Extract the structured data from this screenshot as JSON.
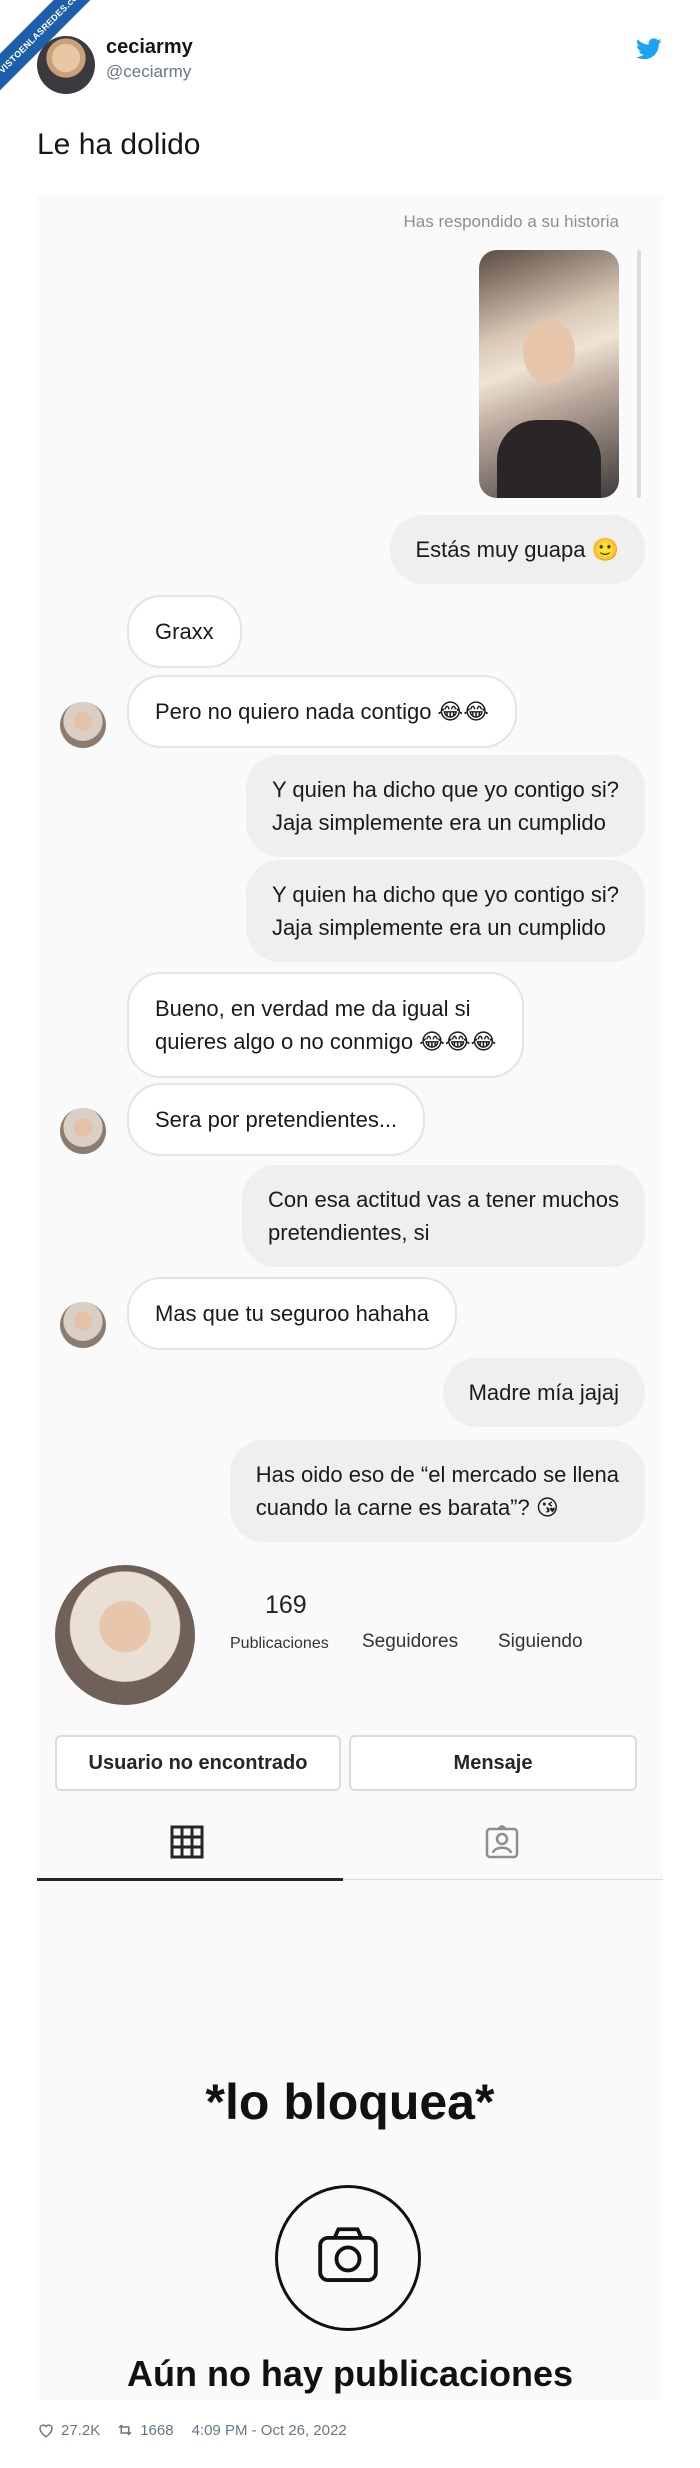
{
  "tweet": {
    "ribbon": "VISTOENLASREDES.com",
    "author_name": "ceciarmy",
    "author_handle": "@ceciarmy",
    "text": "Le ha dolido",
    "likes": "27.2K",
    "retweets": "1668",
    "timestamp": "4:09 PM - Oct 26, 2022"
  },
  "chat": {
    "reply_note": "Has respondido a su historia",
    "messages": [
      {
        "side": "out",
        "text": "Estás muy guapa 🙂"
      },
      {
        "side": "in",
        "text": "Graxx"
      },
      {
        "side": "in",
        "text": "Pero no quiero nada contigo 😂😂"
      },
      {
        "side": "out",
        "text": "Y quien ha dicho que yo contigo si?\nJaja simplemente era un cumplido"
      },
      {
        "side": "out",
        "text": "Y quien ha dicho que yo contigo si?\nJaja simplemente era un cumplido"
      },
      {
        "side": "in",
        "text": "Bueno, en verdad me da igual si\nquieres algo o no conmigo 😂😂😂"
      },
      {
        "side": "in",
        "text": "Sera por pretendientes..."
      },
      {
        "side": "out",
        "text": "Con esa actitud vas a tener muchos\npretendientes, si"
      },
      {
        "side": "in",
        "text": "Mas que tu seguroo hahaha"
      },
      {
        "side": "out",
        "text": "Madre mía jajaj"
      },
      {
        "side": "out",
        "text": "Has oido eso de “el mercado se llena\ncuando la carne es barata”? 😘"
      }
    ]
  },
  "profile": {
    "posts_count": "169",
    "posts_label": "Publicaciones",
    "followers_label": "Seguidores",
    "following_label": "Siguiendo",
    "user_button": "Usuario no encontrado",
    "message_button": "Mensaje",
    "caption": "*lo bloquea*",
    "empty_state": "Aún no hay publicaciones"
  },
  "colors": {
    "twitter_blue": "#1da1f2",
    "incoming_bubble": "#ffffff",
    "outgoing_bubble": "#efefef"
  }
}
